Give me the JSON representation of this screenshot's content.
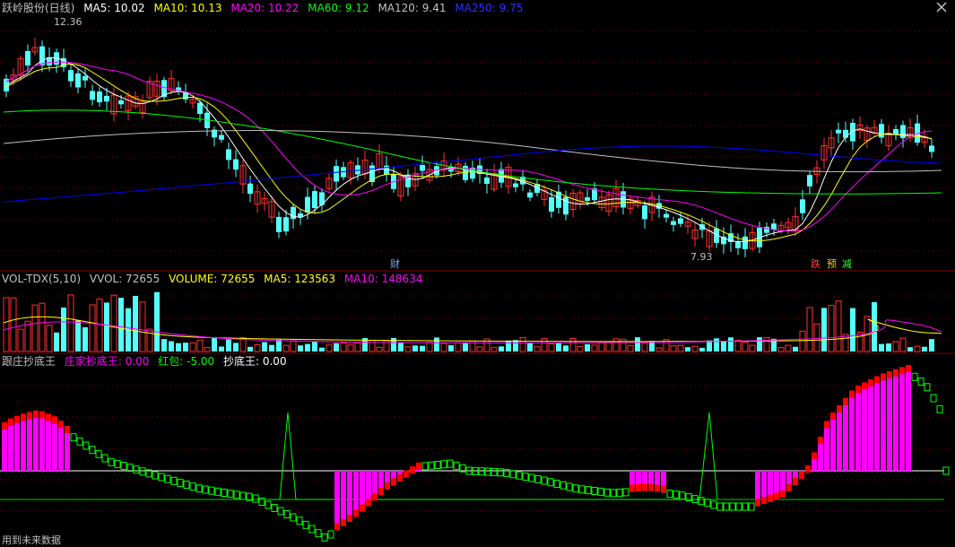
{
  "main_header": {
    "title": "跃岭股份(日线)",
    "ma5": "MA5: 10.02",
    "ma10": "MA10: 10.13",
    "ma20": "MA20: 10.22",
    "ma60": "MA60: 9.12",
    "ma120": "MA120: 9.41",
    "ma250": "MA250: 9.75"
  },
  "vol_header": {
    "title": "VOL-TDX(5,10)",
    "vvol": "VVOL: 72655",
    "volume": "VOLUME: 72655",
    "ma5": "MA5: 123563",
    "ma10": "MA10: 148634"
  },
  "ind_header": {
    "title": "跟庄抄底王",
    "zhuang": "庄家抄底王: 0.00",
    "hongbao": "红包: -5.00",
    "chaodi": "抄底王: 0.00"
  },
  "price_labels": {
    "high": "12.36",
    "low": "7.93"
  },
  "flags": {
    "cai": "财",
    "die": "跌",
    "yu": "预",
    "jian": "减"
  },
  "footer": "用到未来数据",
  "colors": {
    "up": "#ff3232",
    "down": "#54ffff",
    "ma5": "#ffffff",
    "ma10": "#ffff00",
    "ma20": "#ff00ff",
    "ma60": "#00ff00",
    "ma120": "#c0c0c0",
    "ma250": "#0000ff",
    "bar_magenta": "#ff00ff",
    "bar_red": "#ff0000",
    "bar_yellow": "#ffff00",
    "grid": "#8b0000"
  }
}
